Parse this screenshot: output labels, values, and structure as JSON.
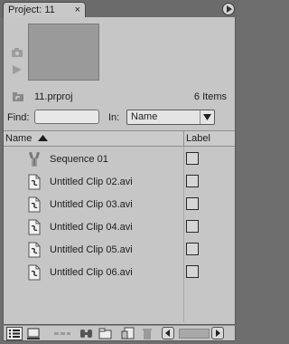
{
  "tab": {
    "title": "Project: 11",
    "close_glyph": "×"
  },
  "project": {
    "name": "11.prproj",
    "item_count": "6 Items"
  },
  "find": {
    "label": "Find:",
    "value": "",
    "placeholder": ""
  },
  "in_filter": {
    "label": "In:",
    "selected": "Name"
  },
  "columns": {
    "name": "Name",
    "label": "Label"
  },
  "items": [
    {
      "name": "Sequence 01",
      "icon": "sequence-icon"
    },
    {
      "name": "Untitled Clip 02.avi",
      "icon": "clip-file-icon"
    },
    {
      "name": "Untitled Clip 03.avi",
      "icon": "clip-file-icon"
    },
    {
      "name": "Untitled Clip 04.avi",
      "icon": "clip-file-icon"
    },
    {
      "name": "Untitled Clip 05.avi",
      "icon": "clip-file-icon"
    },
    {
      "name": "Untitled Clip 06.avi",
      "icon": "clip-file-icon"
    }
  ],
  "toolbar_icons": [
    "list-view-icon",
    "icon-view-icon",
    "automate-to-sequence-icon",
    "find-icon",
    "new-bin-icon",
    "new-item-icon",
    "clear-icon",
    "scroll-left-icon",
    "scroll-right-icon"
  ],
  "colors": {
    "panel_bg": "#c6c6c6",
    "outer_bg": "#6e6e6e",
    "thumbnail": "#9a9a9a"
  }
}
